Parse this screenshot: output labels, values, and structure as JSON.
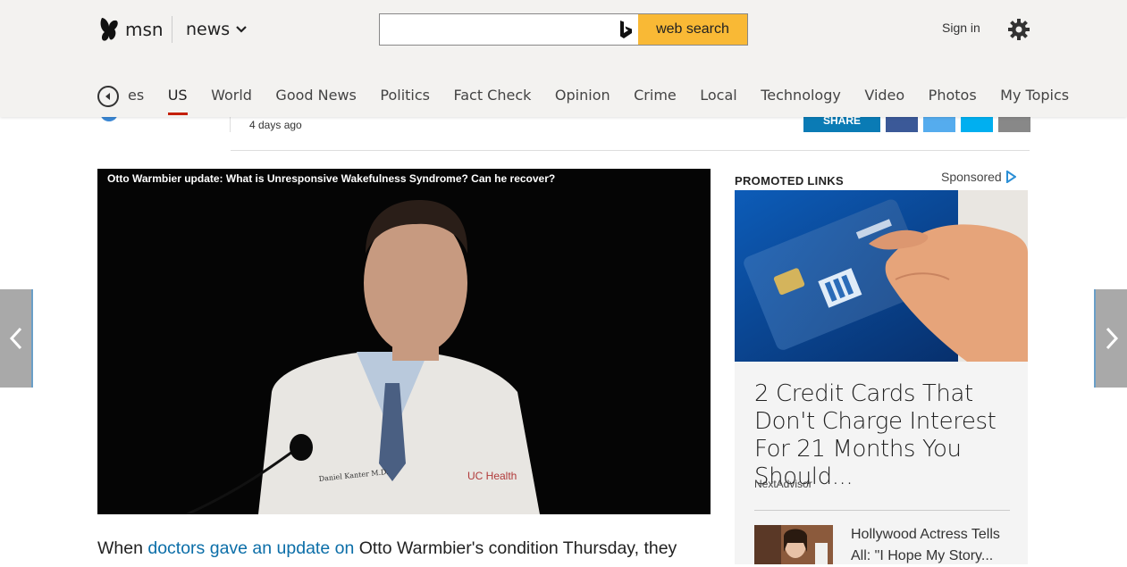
{
  "header": {
    "brand": "msn",
    "section": "news",
    "search": {
      "placeholder": "",
      "button_label": "web search"
    },
    "signin_label": "Sign in"
  },
  "nav": {
    "items": [
      "es",
      "US",
      "World",
      "Good News",
      "Politics",
      "Fact Check",
      "Opinion",
      "Crime",
      "Local",
      "Technology",
      "Video",
      "Photos",
      "My Topics"
    ],
    "active": "US"
  },
  "article": {
    "time_ago": "4 days ago",
    "share_label": "SHARE",
    "video_title": "Otto Warmbier update: What is Unresponsive Wakefulness Syndrome? Can he recover?",
    "video_nameplate": "Daniel Kanter M.D.",
    "video_logo": "UC Health",
    "body_before": "When ",
    "body_link": "doctors gave an update on",
    "body_after": " Otto Warmbier's condition Thursday, they"
  },
  "sidebar": {
    "promoted_label": "PROMOTED LINKS",
    "sponsored_label": "Sponsored",
    "ad1_headline": "2 Credit Cards That Don't Charge Interest For 21 Months You Should...",
    "ad1_source": "NextAdvisor",
    "ad2_headline": "Hollywood Actress Tells All: \"I Hope My Story..."
  },
  "colors": {
    "accent": "#f9b935",
    "active_underline": "#c41f00",
    "link": "#0b6ea8"
  }
}
